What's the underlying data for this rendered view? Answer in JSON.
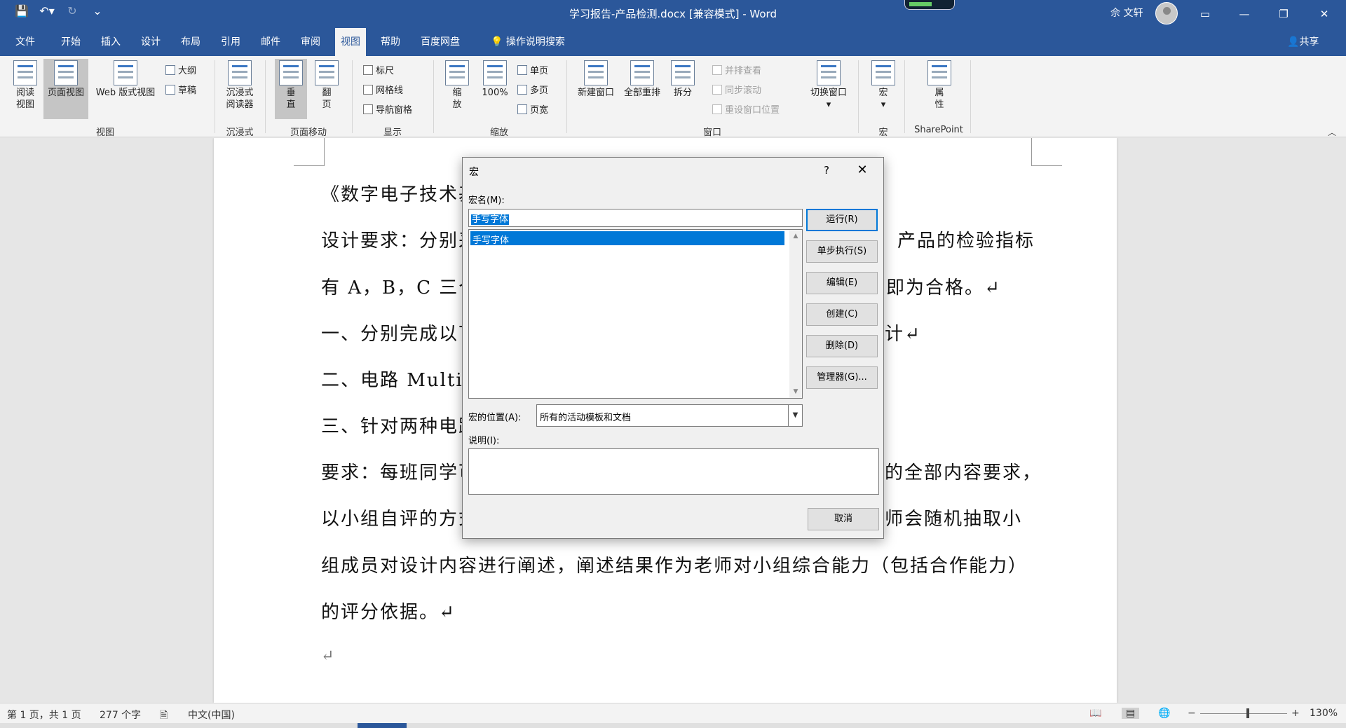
{
  "titlebar": {
    "qat": {
      "save_icon": "save-icon",
      "undo_icon": "undo-icon",
      "redo_icon": "redo-icon",
      "customize_icon": "customize-qat-icon"
    },
    "title": "学习报告-产品检测.docx [兼容模式] - Word",
    "user": "佘 文轩",
    "controls": {
      "ribbon_display": "▭",
      "minimize": "—",
      "restore": "❐",
      "close": "✕"
    }
  },
  "tabs": [
    "文件",
    "开始",
    "插入",
    "设计",
    "布局",
    "引用",
    "邮件",
    "审阅",
    "视图",
    "帮助",
    "百度网盘"
  ],
  "active_tab": "视图",
  "search_tell": "操作说明搜索",
  "share": "共享",
  "ribbon": {
    "views": {
      "read": "阅读\n视图",
      "print": "页面视图",
      "web": "Web 版式视图",
      "outline": "大纲",
      "draft": "草稿",
      "group": "视图"
    },
    "immersive": {
      "reader": "沉浸式\n阅读器",
      "group": "沉浸式"
    },
    "page_move": {
      "vertical": "垂\n直",
      "side": "翻\n页",
      "group": "页面移动"
    },
    "show": {
      "ruler": "标尺",
      "gridlines": "网格线",
      "nav_pane": "导航窗格",
      "group": "显示"
    },
    "zoom": {
      "zoom": "缩\n放",
      "hundred": "100%",
      "one_page": "单页",
      "multi_page": "多页",
      "page_width": "页宽",
      "group": "缩放"
    },
    "window": {
      "new_window": "新建窗口",
      "arrange_all": "全部重排",
      "split": "拆分",
      "side_by_side": "并排查看",
      "sync_scroll": "同步滚动",
      "reset_position": "重设窗口位置",
      "switch": "切换窗口",
      "group": "窗口"
    },
    "macros": {
      "macros": "宏",
      "group": "宏"
    },
    "sharepoint": {
      "properties": "属\n性",
      "group": "SharePoint"
    }
  },
  "document": {
    "lines": [
      "《数字电子技术基",
      "设计要求：分别采",
      "有 A，B，C 三个，",
      "一、分别完成以下",
      "二、电路 Multisi",
      "三、针对两种电路",
      "要求：每班同学可",
      "以小组自评的方式",
      "组成员对设计内容进行阐述，阐述结果作为老师对小组综合能力（包括合作能力）",
      "的评分依据。↵",
      "↵"
    ],
    "right_fragments": [
      "产品的检验指标",
      "即为合格。↵",
      "计↵",
      "的全部内容要求，",
      "师会随机抽取小"
    ]
  },
  "dialog": {
    "title": "宏",
    "help": "?",
    "close": "✕",
    "macro_name_label": "宏名(M):",
    "macro_name_value": "手写字体",
    "macro_list": [
      "手写字体"
    ],
    "buttons": {
      "run": "运行(R)",
      "step": "单步执行(S)",
      "edit": "编辑(E)",
      "create": "创建(C)",
      "delete": "删除(D)",
      "organizer": "管理器(G)...",
      "cancel": "取消"
    },
    "location_label": "宏的位置(A):",
    "location_value": "所有的活动模板和文档",
    "description_label": "说明(I):"
  },
  "statusbar": {
    "page": "第 1 页，共 1 页",
    "words": "277 个字",
    "language": "中文(中国)",
    "zoom_minus": "−",
    "zoom_plus": "+",
    "zoom": "130%"
  },
  "colors": {
    "accent": "#2b579a",
    "selection": "#0078d7"
  }
}
